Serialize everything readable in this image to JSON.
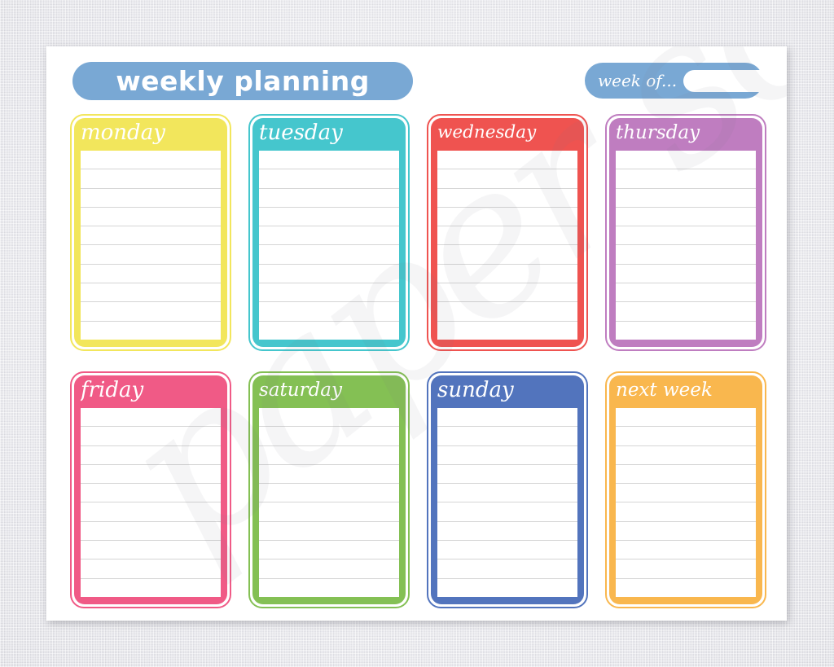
{
  "page": {
    "background_color": "#e9e9ee",
    "sheet_color": "#ffffff",
    "watermark_text": "paper source"
  },
  "header": {
    "title": "weekly planning",
    "title_pill_color": "#79a8d4",
    "week_of": {
      "label": "week of...",
      "value": "",
      "placeholder": "",
      "pill_color": "#79a8d4",
      "field_color": "#ffffff"
    }
  },
  "cards": [
    {
      "id": "monday",
      "label": "monday",
      "color": "#f2e65c",
      "title_size": "normal",
      "lines": 10
    },
    {
      "id": "tuesday",
      "label": "tuesday",
      "color": "#45c6cd",
      "title_size": "normal",
      "lines": 10
    },
    {
      "id": "wednesday",
      "label": "wednesday",
      "color": "#ef5350",
      "title_size": "xsmall",
      "lines": 10
    },
    {
      "id": "thursday",
      "label": "thursday",
      "color": "#bf7dc0",
      "title_size": "small",
      "lines": 10
    },
    {
      "id": "friday",
      "label": "friday",
      "color": "#f05a86",
      "title_size": "normal",
      "lines": 10
    },
    {
      "id": "saturday",
      "label": "saturday",
      "color": "#84c054",
      "title_size": "small",
      "lines": 10
    },
    {
      "id": "sunday",
      "label": "sunday",
      "color": "#5274bd",
      "title_size": "normal",
      "lines": 10
    },
    {
      "id": "nextweek",
      "label": "next week",
      "color": "#f9b74e",
      "title_size": "small",
      "lines": 10
    }
  ]
}
